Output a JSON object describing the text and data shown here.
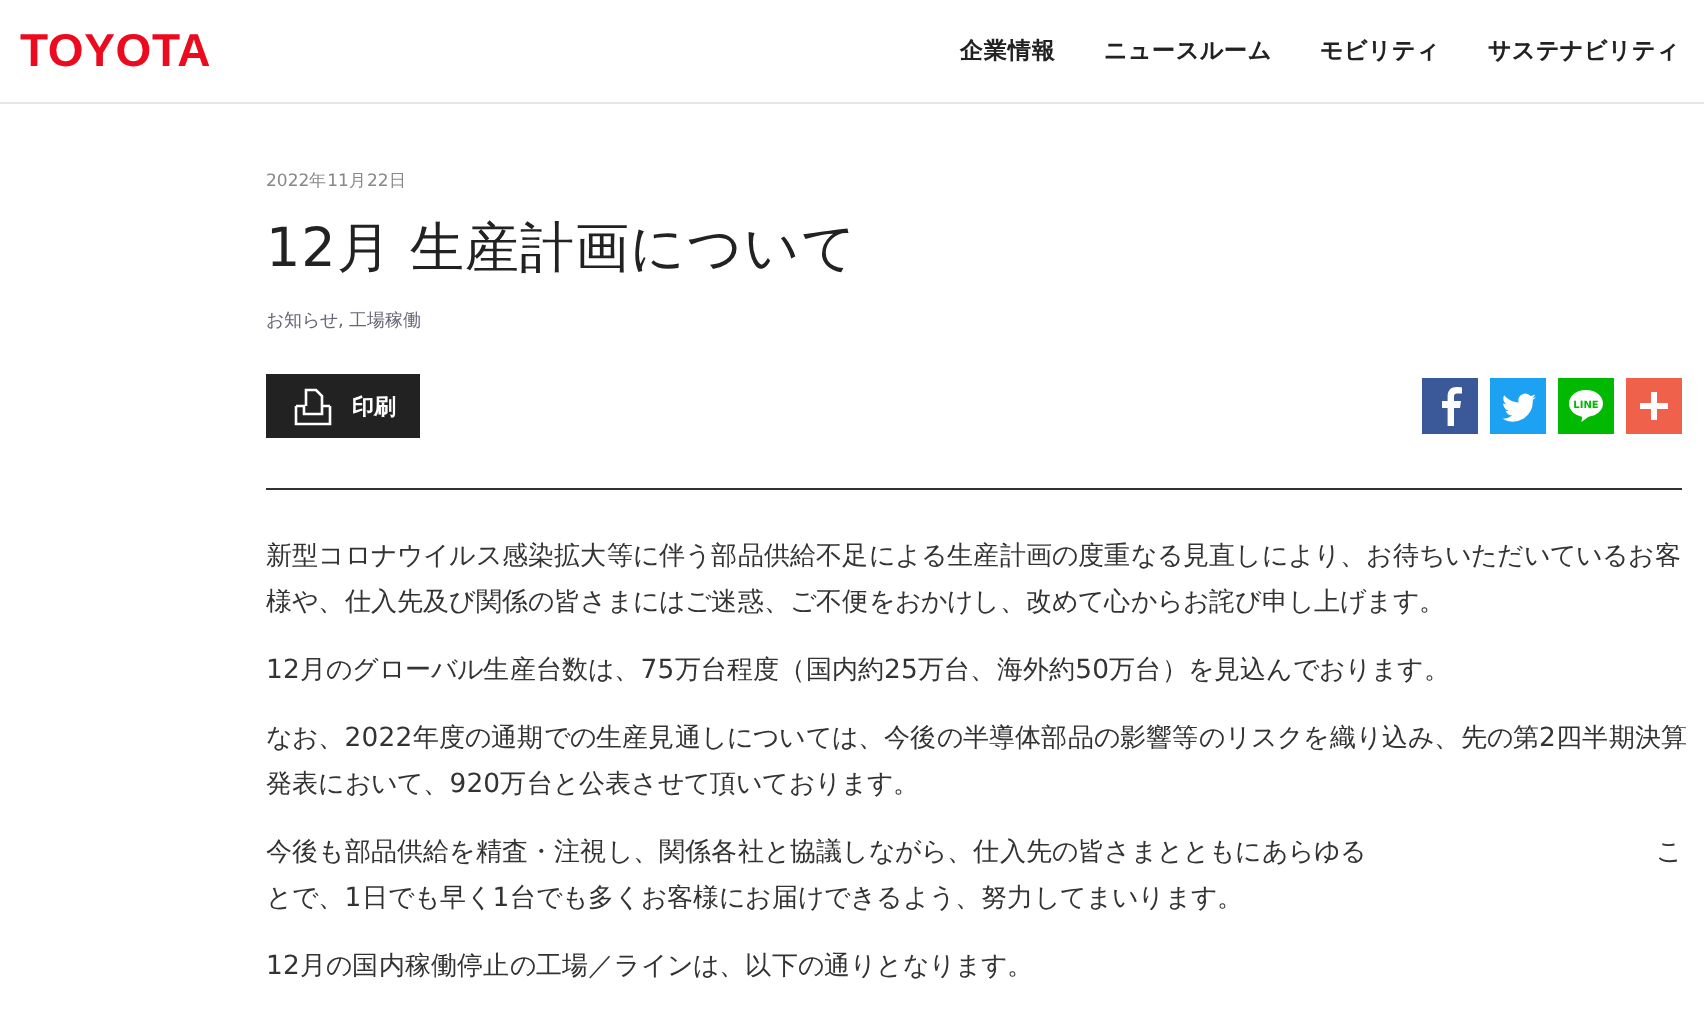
{
  "header": {
    "logo": "TOYOTA",
    "nav": [
      "企業情報",
      "ニュースルーム",
      "モビリティ",
      "サステナビリティ"
    ]
  },
  "article": {
    "date": "2022年11月22日",
    "title": "12月 生産計画について",
    "tags": "お知らせ, 工場稼働",
    "print_button": "印刷",
    "share": [
      {
        "kind": "facebook"
      },
      {
        "kind": "twitter"
      },
      {
        "kind": "line",
        "label": "LINE"
      },
      {
        "kind": "more"
      }
    ],
    "paragraphs": [
      {
        "lines": [
          [
            "新型コロナウイルス感染拡大等に伴う部品供給不足による生産計画の度重なる見直しにより、お待ちいただいているお客"
          ],
          [
            "様や、仕入先及び関係の皆さまにはご迷惑、ご不便をおかけし、改めて心からお詫び申し上げます。"
          ]
        ]
      },
      {
        "lines": [
          [
            "12月のグローバル生産台数は、75万台程度（国内約25万台、海外約50万台）を見込んでおります。"
          ]
        ]
      },
      {
        "lines": [
          [
            "なお、2022年度の通期での生産見通しについては、今後の半導体部品の影響等のリスクを織り込み、先の第2四半期決算"
          ],
          [
            "発表において、920万台と公表させて頂いております。"
          ]
        ]
      },
      {
        "lines": [
          [
            "今後も部品供給を精査・注視し、関係各社と協議しながら、仕入先の皆さまとともにあらゆる",
            "こ"
          ],
          [
            "とで、1日でも早く1台でも多くお客様にお届けできるよう、努力してまいります。"
          ]
        ]
      },
      {
        "lines": [
          [
            "12月の国内稼働停止の工場／ラインは、以下の通りとなります。"
          ]
        ]
      }
    ]
  }
}
